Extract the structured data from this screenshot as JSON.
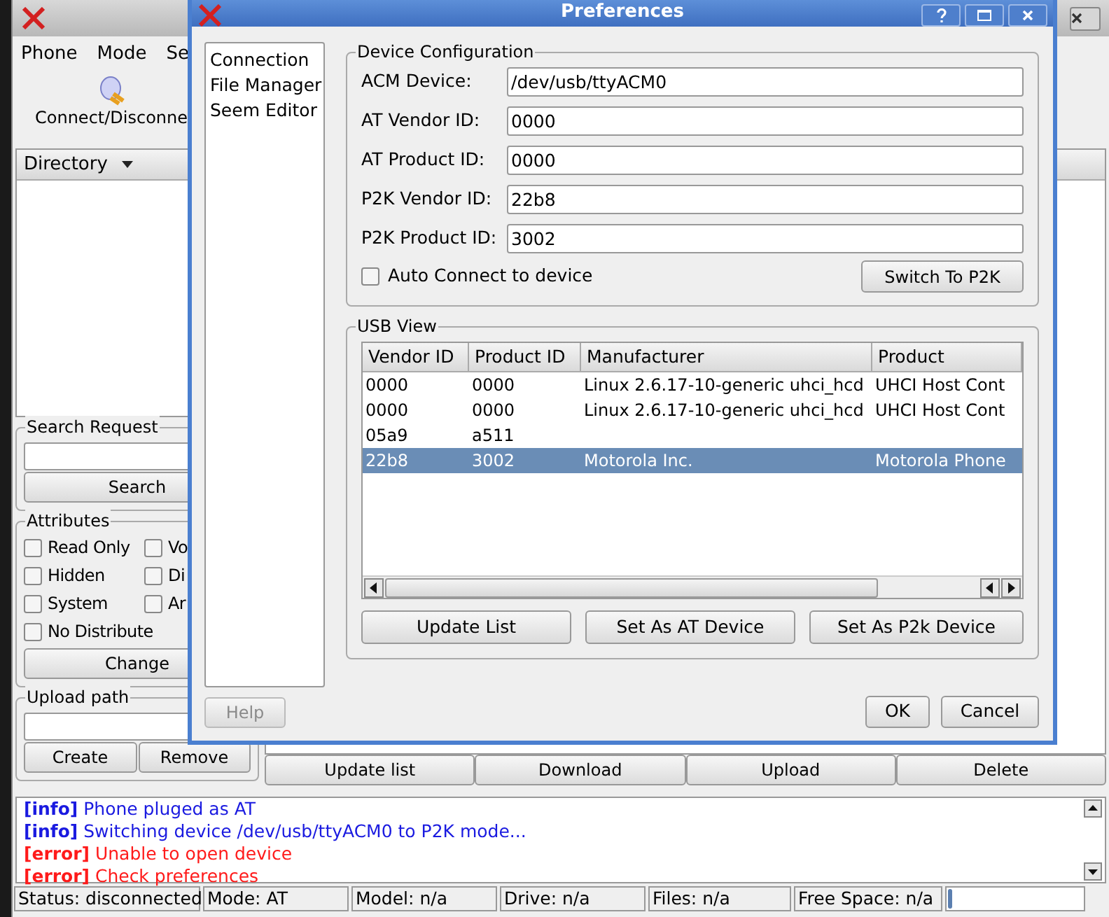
{
  "main_window": {
    "menu": [
      "Phone",
      "Mode",
      "Se"
    ],
    "toolbar": {
      "label": "Connect/Disconne"
    },
    "directory_header": "Directory",
    "search_request": {
      "title": "Search Request",
      "button": "Search"
    },
    "attributes": {
      "title": "Attributes",
      "checkboxes": [
        {
          "label": "Read Only",
          "checked": false
        },
        {
          "label": "Vo",
          "checked": false
        },
        {
          "label": "Hidden",
          "checked": false
        },
        {
          "label": "Di",
          "checked": false
        },
        {
          "label": "System",
          "checked": false
        },
        {
          "label": "Ar",
          "checked": false
        },
        {
          "label": "No Distribute",
          "checked": false
        }
      ],
      "button": "Change"
    },
    "upload_path": {
      "title": "Upload path",
      "buttons": [
        "Create",
        "Remove"
      ]
    },
    "file_buttons": [
      "Update list",
      "Download",
      "Upload",
      "Delete"
    ],
    "log": [
      {
        "kind": "info",
        "text": "**[info]** Phone pluged as AT"
      },
      {
        "kind": "info",
        "text": "**[info]** Switching device /dev/usb/ttyACM0 to P2K mode..."
      },
      {
        "kind": "error",
        "text": "**[error]** Unable to open device"
      },
      {
        "kind": "error",
        "text": "**[error]** Check preferences"
      }
    ],
    "status_bar": [
      "Status: disconnected",
      "Mode: AT",
      "Model: n/a",
      "Drive: n/a",
      "Files: n/a",
      "Free Space: n/a"
    ],
    "progress": {
      "level": 0.03
    }
  },
  "dialog": {
    "title": "Preferences",
    "nav": [
      "Connection",
      "File Manager",
      "Seem Editor"
    ],
    "device_configuration": {
      "title": "Device Configuration",
      "fields": [
        {
          "label": "ACM Device:",
          "value": "/dev/usb/ttyACM0"
        },
        {
          "label": "AT Vendor ID:",
          "value": "0000"
        },
        {
          "label": "AT Product ID:",
          "value": "0000"
        },
        {
          "label": "P2K Vendor ID:",
          "value": "22b8"
        },
        {
          "label": "P2K Product ID:",
          "value": "3002"
        }
      ],
      "auto_connect": {
        "label": "Auto Connect to device",
        "checked": false
      },
      "button": "Switch To P2K"
    },
    "usb_view": {
      "title": "USB View",
      "columns": [
        "Vendor ID",
        "Product ID",
        "Manufacturer",
        "Product"
      ],
      "rows": [
        {
          "cells": [
            "0000",
            "0000",
            "Linux 2.6.17-10-generic uhci_hcd",
            "UHCI Host Cont"
          ],
          "selected": false
        },
        {
          "cells": [
            "0000",
            "0000",
            "Linux 2.6.17-10-generic uhci_hcd",
            "UHCI Host Cont"
          ],
          "selected": false
        },
        {
          "cells": [
            "05a9",
            "a511",
            "",
            ""
          ],
          "selected": false
        },
        {
          "cells": [
            "22b8",
            "3002",
            "Motorola Inc.",
            "Motorola Phone"
          ],
          "selected": true
        }
      ],
      "buttons": [
        "Update List",
        "Set As AT Device",
        "Set As P2k Device"
      ]
    },
    "help": {
      "label": "Help",
      "disabled": true
    },
    "ok": "OK",
    "cancel": "Cancel"
  }
}
